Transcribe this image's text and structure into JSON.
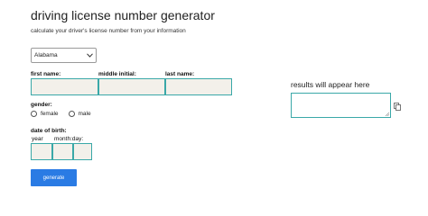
{
  "header": {
    "title": "driving license number generator",
    "subtitle": "calculate your driver's license number from your information"
  },
  "form": {
    "state": {
      "selected": "Alabama"
    },
    "first_name": {
      "label": "first name:",
      "value": ""
    },
    "middle_initial": {
      "label": "middle initial:",
      "value": ""
    },
    "last_name": {
      "label": "last name:",
      "value": ""
    },
    "gender": {
      "label": "gender:",
      "options": [
        "female",
        "male"
      ]
    },
    "dob": {
      "label": "date of birth:",
      "year_label": "year",
      "month_day_label": "month:day:"
    },
    "generate_label": "generate"
  },
  "results": {
    "label": "results will appear here",
    "value": ""
  },
  "colors": {
    "accent": "#2a7be4",
    "field_border": "#3aa8a8",
    "field_fill": "#f3f0ea"
  },
  "icons": {
    "dropdown": "chevron-down-icon",
    "copy": "copy-icon",
    "resize": "resize-grip-icon"
  }
}
